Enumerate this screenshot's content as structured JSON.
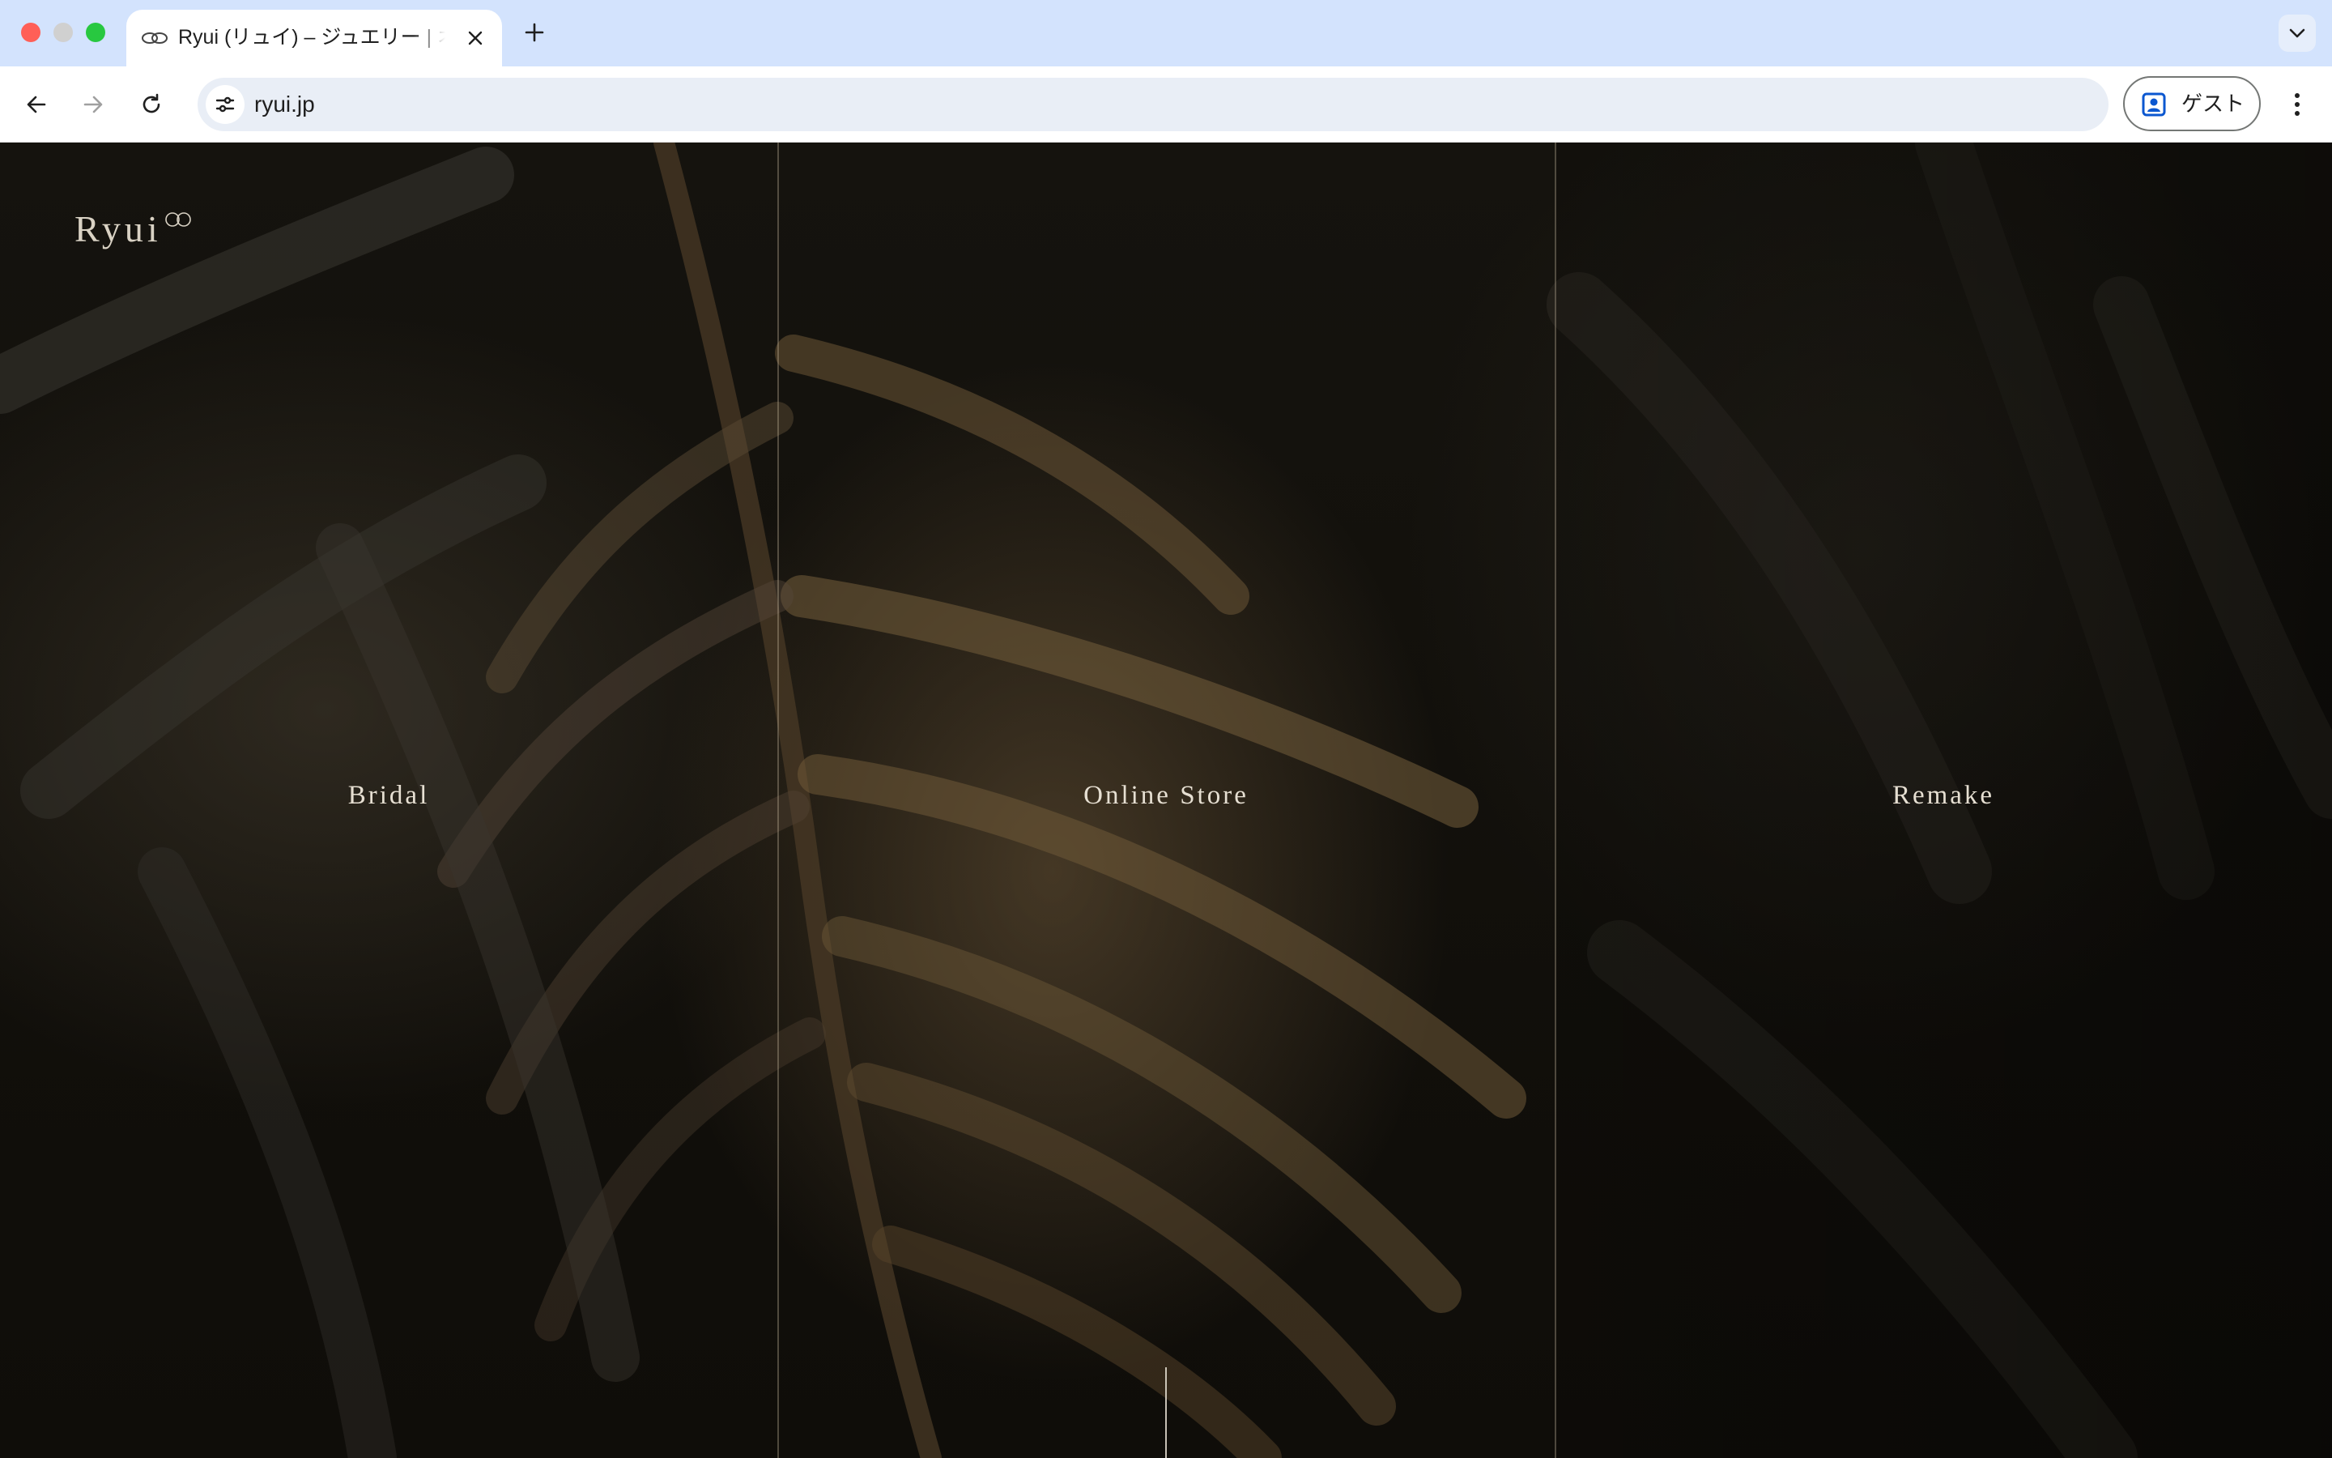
{
  "browser": {
    "tab_title": "Ryui (リュイ) – ジュエリー | オ",
    "url": "ryui.jp",
    "profile_label": "ゲスト",
    "icons": {
      "tab_favicon": "infinity-ring-icon",
      "close": "close-icon",
      "new_tab": "plus-icon",
      "tab_search": "chevron-down-icon",
      "back": "arrow-left-icon",
      "forward": "arrow-right-icon",
      "reload": "reload-icon",
      "site_info": "tune-icon",
      "profile": "person-badge-icon",
      "menu": "kebab-menu-icon"
    }
  },
  "page": {
    "logo_text": "Ryui",
    "sections": [
      {
        "label": "Bridal"
      },
      {
        "label": "Online Store"
      },
      {
        "label": "Remake"
      }
    ]
  },
  "colors": {
    "chrome_tabstrip": "#d3e3fd",
    "chrome_toolbar": "#ffffff",
    "page_text": "#e6dfd2",
    "page_background": "#0f0d09"
  }
}
